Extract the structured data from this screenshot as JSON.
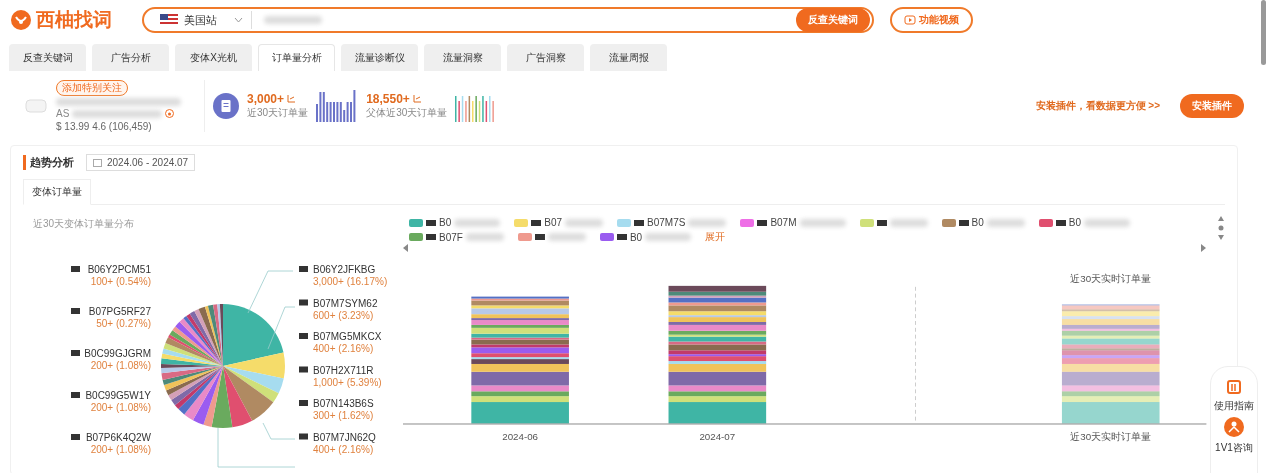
{
  "header": {
    "logo": "西柚找词",
    "site": "美国站",
    "search_button": "反查关键词",
    "video_button": "功能视频"
  },
  "tabs": [
    {
      "label": "反查关键词",
      "selected": false
    },
    {
      "label": "广告分析",
      "selected": false
    },
    {
      "label": "变体X光机",
      "selected": false
    },
    {
      "label": "订单量分析",
      "selected": true
    },
    {
      "label": "流量诊断仪",
      "selected": false
    },
    {
      "label": "流量洞察",
      "selected": false
    },
    {
      "label": "广告洞察",
      "selected": false
    },
    {
      "label": "流量周报",
      "selected": false
    }
  ],
  "product": {
    "follow_badge": "添加特别关注",
    "asin_prefix": "AS",
    "price_line": "$ 13.99 4.6 (106,459)"
  },
  "stats": [
    {
      "value": "3,000+",
      "label": "近30天订单量"
    },
    {
      "value": "18,550+",
      "label": "父体近30天订单量"
    }
  ],
  "install": {
    "hint": "安装插件，看数据更方便 >>",
    "button": "安装插件"
  },
  "trend": {
    "title": "趋势分析",
    "date_range": "2024.06 - 2024.07",
    "subtabs": [
      {
        "label": "变体订单量",
        "selected": true
      }
    ],
    "pie_title": "近30天变体订单量分布",
    "pie_labels_left": [
      {
        "asin": "B06Y2PCM51",
        "value": "100+ (0.54%)"
      },
      {
        "asin": "B07PG5RF27",
        "value": "50+ (0.27%)"
      },
      {
        "asin": "B0C99GJGRM",
        "value": "200+ (1.08%)"
      },
      {
        "asin": "B0C99G5W1Y",
        "value": "200+ (1.08%)"
      },
      {
        "asin": "B07P6K4Q2W",
        "value": "200+ (1.08%)"
      }
    ],
    "pie_labels_right": [
      {
        "asin": "B06Y2JFKBG",
        "value": "3,000+ (16.17%)"
      },
      {
        "asin": "B07M7SYM62",
        "value": "600+ (3.23%)"
      },
      {
        "asin": "B07MG5MKCX",
        "value": "400+ (2.16%)"
      },
      {
        "asin": "B07H2X711R",
        "value": "1,000+ (5.39%)"
      },
      {
        "asin": "B07N143B6S",
        "value": "300+ (1.62%)"
      },
      {
        "asin": "B07M7JN62Q",
        "value": "400+ (2.16%)"
      }
    ],
    "legend": [
      {
        "color": "#3fb5a5",
        "text": "B0"
      },
      {
        "color": "#f5dc6a",
        "text": "B07"
      },
      {
        "color": "#a6dcef",
        "text": "B07M7S"
      },
      {
        "color": "#ee6ee6",
        "text": "B07M"
      },
      {
        "color": "#cfe07a"
      },
      {
        "color": "#b08a62",
        "text": "B0"
      },
      {
        "color": "#e04f6f",
        "text": "B0"
      },
      {
        "color": "#6aaa5e",
        "text": "B07F"
      },
      {
        "color": "#ef9a8e"
      },
      {
        "color": "#9a5cf0",
        "text": "B0"
      }
    ],
    "legend_toggle": "展开",
    "bar_title": "近30天实时订单量",
    "x_labels": [
      "2024-06",
      "2024-07",
      "近30天实时订单量"
    ]
  },
  "help": [
    "使用指南",
    "1V1咨询"
  ]
}
